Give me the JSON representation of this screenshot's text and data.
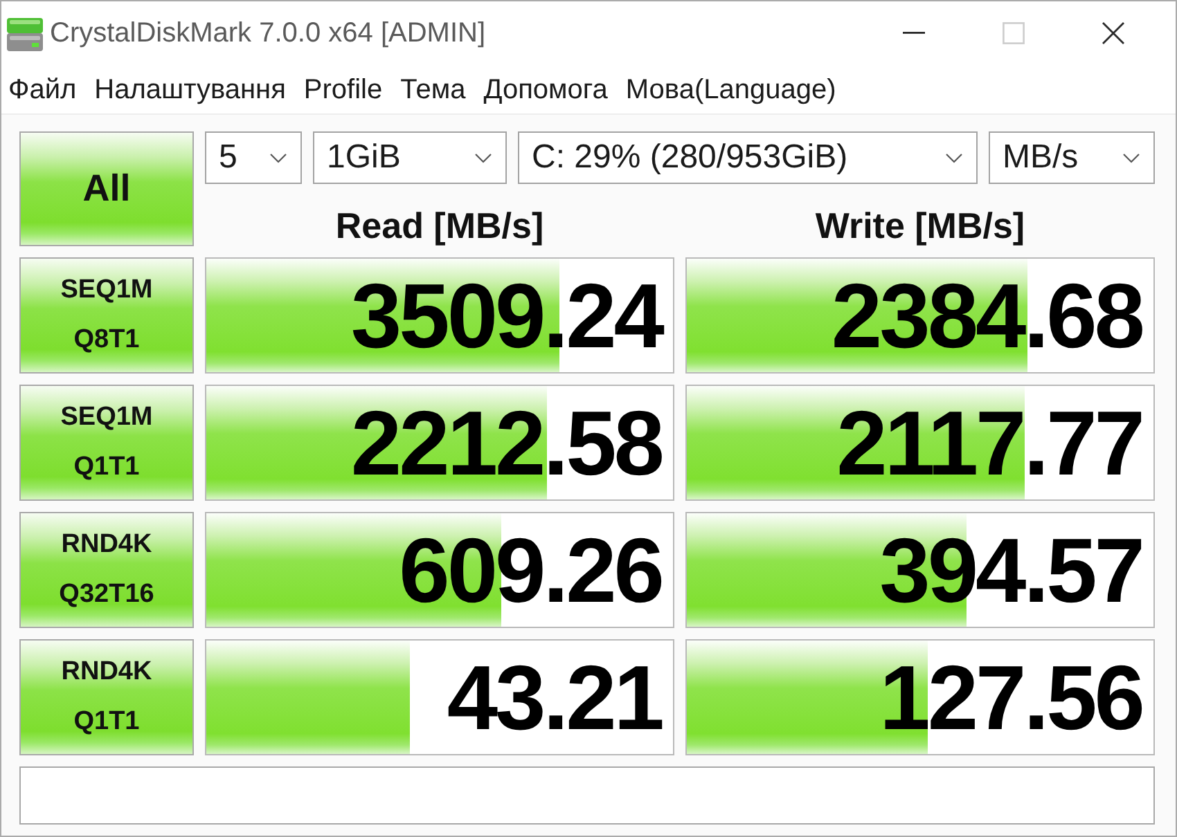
{
  "window": {
    "title": "CrystalDiskMark 7.0.0 x64 [ADMIN]",
    "controls": [
      {
        "kind": "minimize",
        "disabled": false
      },
      {
        "kind": "maximize",
        "disabled": true
      },
      {
        "kind": "close",
        "disabled": false
      }
    ]
  },
  "menu": [
    "Файл",
    "Налаштування",
    "Profile",
    "Тема",
    "Допомога",
    "Мова(Language)"
  ],
  "all_button": "All",
  "settings": [
    {
      "kind": "count",
      "value": "5"
    },
    {
      "kind": "size",
      "value": "1GiB"
    },
    {
      "kind": "drive",
      "value": "C: 29% (280/953GiB)"
    },
    {
      "kind": "unit",
      "value": "MB/s"
    }
  ],
  "columns": [
    "Read [MB/s]",
    "Write [MB/s]"
  ],
  "tests": [
    {
      "name": "SEQ1M",
      "params": "Q8T1",
      "read": {
        "value": "3509.24",
        "level": 0.758
      },
      "write": {
        "value": "2384.68",
        "level": 0.729
      }
    },
    {
      "name": "SEQ1M",
      "params": "Q1T1",
      "read": {
        "value": "2212.58",
        "level": 0.729
      },
      "write": {
        "value": "2117.77",
        "level": 0.723
      }
    },
    {
      "name": "RND4K",
      "params": "Q32T16",
      "read": {
        "value": "609.26",
        "level": 0.631
      },
      "write": {
        "value": "394.57",
        "level": 0.599
      }
    },
    {
      "name": "RND4K",
      "params": "Q1T1",
      "read": {
        "value": "43.21",
        "level": 0.437
      },
      "write": {
        "value": "127.56",
        "level": 0.516
      }
    }
  ]
}
